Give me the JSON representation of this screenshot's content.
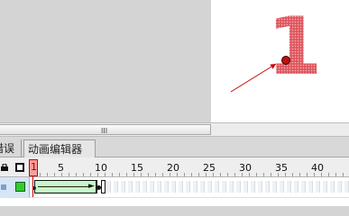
{
  "stage": {
    "digit": "1"
  },
  "scrollbar": {
    "grip": "III"
  },
  "panel_tabs": {
    "errors_label": "错误",
    "motion_editor_label": "动画编辑器"
  },
  "timeline": {
    "current_frame": "1",
    "frame_labels": [
      "5",
      "10",
      "15",
      "20",
      "25",
      "30",
      "35",
      "40"
    ]
  },
  "colors": {
    "digit_red": "#d6202a",
    "playhead_red": "#cc0000",
    "tween_green": "#c9f5c9",
    "outline_green": "#33cc33"
  }
}
